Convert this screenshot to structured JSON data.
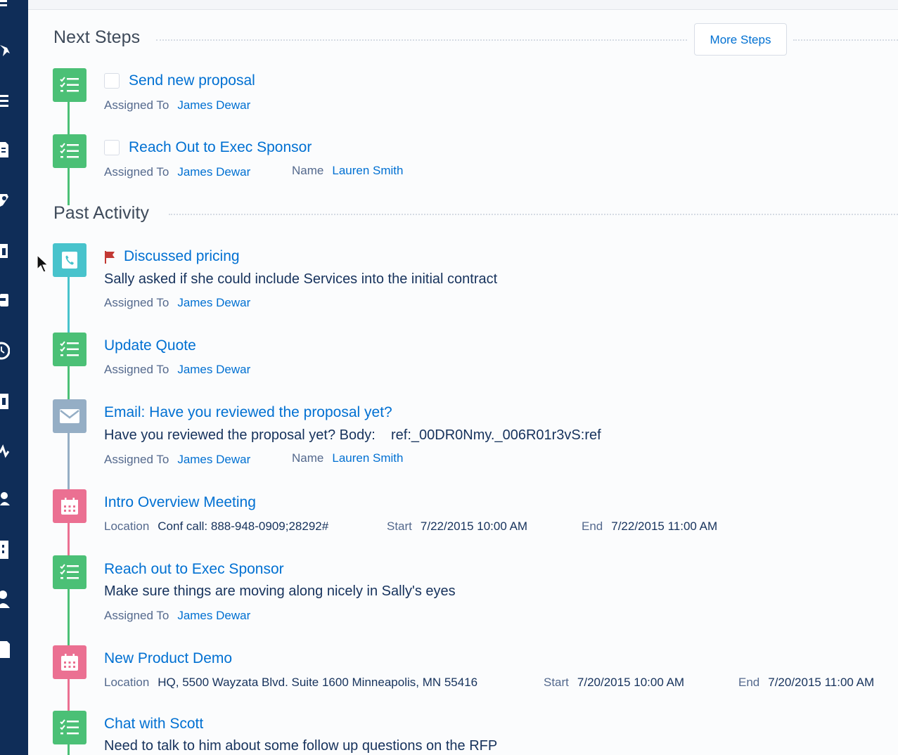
{
  "sidebar": {
    "icons": [
      "app-icon",
      "star-icon",
      "list-icon",
      "document-icon",
      "edit-icon",
      "calendar-icon",
      "card-icon",
      "clock-icon",
      "clipboard-icon",
      "pulse-icon",
      "group-icon",
      "building-icon",
      "person-icon",
      "file-icon"
    ]
  },
  "next_steps": {
    "title": "Next Steps",
    "more_button": "More Steps",
    "items": [
      {
        "type": "task",
        "title": "Send new proposal",
        "assigned_label": "Assigned To",
        "assigned_to": "James Dewar"
      },
      {
        "type": "task",
        "title": "Reach Out to Exec Sponsor",
        "assigned_label": "Assigned To",
        "assigned_to": "James Dewar",
        "name_label": "Name",
        "name": "Lauren Smith"
      }
    ]
  },
  "past_activity": {
    "title": "Past Activity",
    "items": [
      {
        "type": "call",
        "title": "Discussed pricing",
        "description": "Sally asked if she could include Services into the initial contract",
        "assigned_label": "Assigned To",
        "assigned_to": "James Dewar"
      },
      {
        "type": "task",
        "title": "Update Quote",
        "assigned_label": "Assigned To",
        "assigned_to": "James Dewar"
      },
      {
        "type": "email",
        "title": "Email: Have you reviewed the proposal yet?",
        "description": "Have you reviewed the proposal yet? Body:    ref:_00DR0Nmy._006R01r3vS:ref",
        "assigned_label": "Assigned To",
        "assigned_to": "James Dewar",
        "name_label": "Name",
        "name": "Lauren Smith"
      },
      {
        "type": "event",
        "title": "Intro Overview Meeting",
        "location_label": "Location",
        "location": "Conf call: 888-948-0909;28292#",
        "start_label": "Start",
        "start": "7/22/2015 10:00 AM",
        "end_label": "End",
        "end": "7/22/2015 11:00 AM"
      },
      {
        "type": "task",
        "title": "Reach out to Exec Sponsor",
        "description": "Make sure things are moving along nicely in Sally's eyes",
        "assigned_label": "Assigned To",
        "assigned_to": "James Dewar"
      },
      {
        "type": "event",
        "title": "New Product Demo",
        "location_label": "Location",
        "location": "HQ, 5500 Wayzata Blvd. Suite 1600 Minneapolis, MN 55416",
        "start_label": "Start",
        "start": "7/20/2015 10:00 AM",
        "end_label": "End",
        "end": "7/20/2015 11:00 AM"
      },
      {
        "type": "task",
        "title": "Chat with Scott",
        "description": "Need to talk to him about some follow up questions on the RFP"
      }
    ]
  },
  "colors": {
    "task": "#4bc076",
    "call": "#48c3cc",
    "email": "#95aec5",
    "event": "#eb7092",
    "link": "#0070d2",
    "flag": "#c23934",
    "sidebar": "#0f2d58"
  }
}
